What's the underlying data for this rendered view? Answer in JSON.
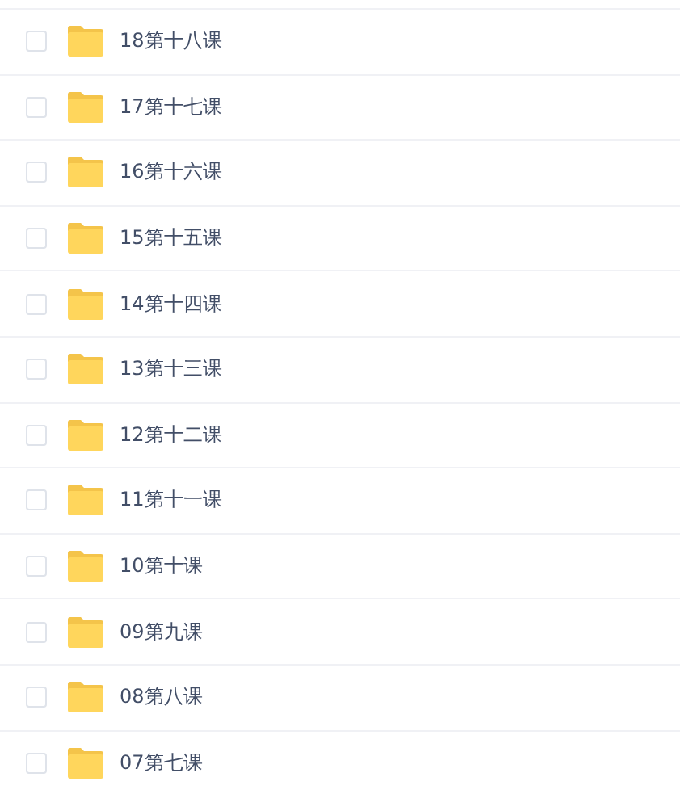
{
  "rows": [
    {
      "name": "18第十八课",
      "checked": false
    },
    {
      "name": "17第十七课",
      "checked": false
    },
    {
      "name": "16第十六课",
      "checked": false
    },
    {
      "name": "15第十五课",
      "checked": false
    },
    {
      "name": "14第十四课",
      "checked": false
    },
    {
      "name": "13第十三课",
      "checked": false
    },
    {
      "name": "12第十二课",
      "checked": false
    },
    {
      "name": "11第十一课",
      "checked": false
    },
    {
      "name": "10第十课",
      "checked": false
    },
    {
      "name": "09第九课",
      "checked": false
    },
    {
      "name": "08第八课",
      "checked": false
    },
    {
      "name": "07第七课",
      "checked": false
    }
  ]
}
